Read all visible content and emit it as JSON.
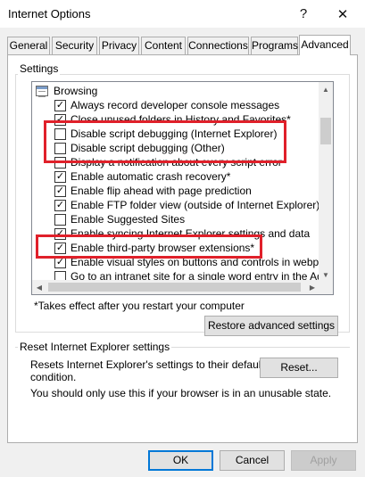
{
  "window": {
    "title": "Internet Options",
    "help_glyph": "?",
    "close_glyph": "✕"
  },
  "tabs": [
    {
      "label": "General"
    },
    {
      "label": "Security"
    },
    {
      "label": "Privacy"
    },
    {
      "label": "Content"
    },
    {
      "label": "Connections"
    },
    {
      "label": "Programs"
    },
    {
      "label": "Advanced",
      "active": true
    }
  ],
  "settings": {
    "group_label": "Settings",
    "category": "Browsing",
    "items": [
      {
        "label": "Always record developer console messages",
        "checked": true
      },
      {
        "label": "Close unused folders in History and Favorites*",
        "checked": true
      },
      {
        "label": "Disable script debugging (Internet Explorer)",
        "checked": false
      },
      {
        "label": "Disable script debugging (Other)",
        "checked": false
      },
      {
        "label": "Display a notification about every script error",
        "checked": false
      },
      {
        "label": "Enable automatic crash recovery*",
        "checked": true
      },
      {
        "label": "Enable flip ahead with page prediction",
        "checked": true
      },
      {
        "label": "Enable FTP folder view (outside of Internet Explorer)",
        "checked": true
      },
      {
        "label": "Enable Suggested Sites",
        "checked": false
      },
      {
        "label": "Enable syncing Internet Explorer settings and data",
        "checked": true
      },
      {
        "label": "Enable third-party browser extensions*",
        "checked": true
      },
      {
        "label": "Enable visual styles on buttons and controls in webpages",
        "checked": true
      },
      {
        "label": "Go to an intranet site for a single word entry in the Address bar",
        "checked": false
      }
    ],
    "note": "*Takes effect after you restart your computer",
    "restore_button": "Restore advanced settings"
  },
  "reset": {
    "group_label": "Reset Internet Explorer settings",
    "description_line1": "Resets Internet Explorer's settings to their default",
    "description_line2": "condition.",
    "reset_button": "Reset...",
    "warning": "You should only use this if your browser is in an unusable state."
  },
  "footer": {
    "ok": "OK",
    "cancel": "Cancel",
    "apply": "Apply"
  },
  "colors": {
    "highlight": "#e0202a",
    "default_button_border": "#0078d7"
  }
}
